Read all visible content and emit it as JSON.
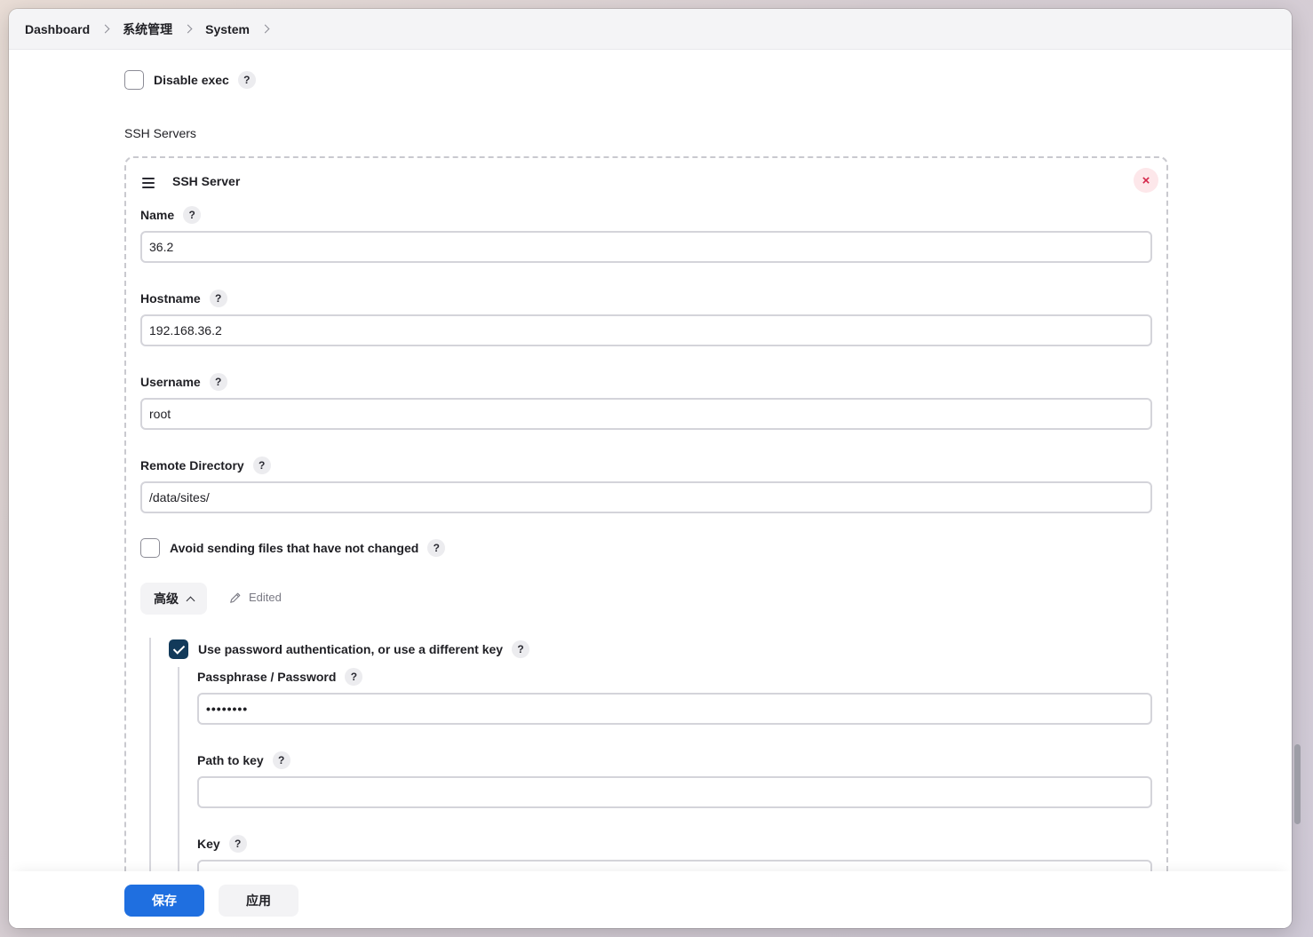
{
  "breadcrumb": [
    "Dashboard",
    "系统管理",
    "System"
  ],
  "disable_exec": {
    "label": "Disable exec",
    "checked": false
  },
  "ssh_servers_title": "SSH Servers",
  "ssh_server": {
    "title": "SSH Server",
    "fields": {
      "name": {
        "label": "Name",
        "value": "36.2"
      },
      "hostname": {
        "label": "Hostname",
        "value": "192.168.36.2"
      },
      "username": {
        "label": "Username",
        "value": "root"
      },
      "remote_directory": {
        "label": "Remote Directory",
        "value": "/data/sites/"
      }
    },
    "avoid_sending": {
      "label": "Avoid sending files that have not changed",
      "checked": false
    },
    "advanced": {
      "label": "高级",
      "edited_label": "Edited"
    },
    "use_password": {
      "label": "Use password authentication, or use a different key",
      "checked": true
    },
    "passphrase": {
      "label": "Passphrase / Password",
      "value": "••••••••"
    },
    "path_to_key": {
      "label": "Path to key",
      "value": ""
    },
    "key": {
      "label": "Key",
      "value": ""
    }
  },
  "help_glyph": "?",
  "close_glyph": "×",
  "footer": {
    "save_label": "保存",
    "apply_label": "应用"
  },
  "colors": {
    "primary": "#1f6fe0",
    "checkbox_checked": "#123a5a",
    "danger": "#d4264a"
  }
}
